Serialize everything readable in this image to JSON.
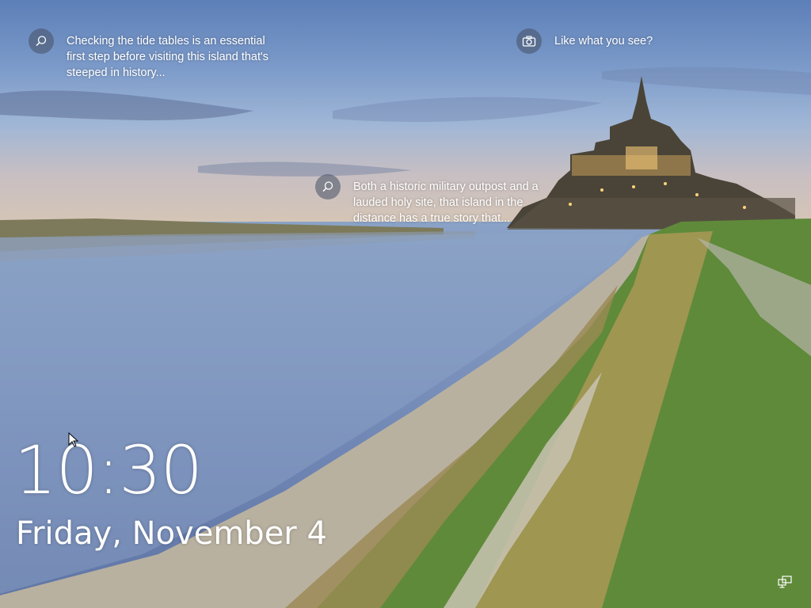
{
  "hints": [
    {
      "icon": "search-icon",
      "text": "Checking the tide tables is an essential first step before visiting this island that's steeped in history..."
    },
    {
      "icon": "search-icon",
      "text": "Both a historic military outpost and a lauded holy site, that island in the distance has a true story that..."
    },
    {
      "icon": "camera-icon",
      "text": "Like what you see?"
    }
  ],
  "clock": {
    "time": "10:30",
    "date": "Friday, November 4"
  },
  "status": {
    "network_icon": "network-icon"
  },
  "colors": {
    "text": "#ffffff",
    "hint_icon_bg": "#465064"
  }
}
